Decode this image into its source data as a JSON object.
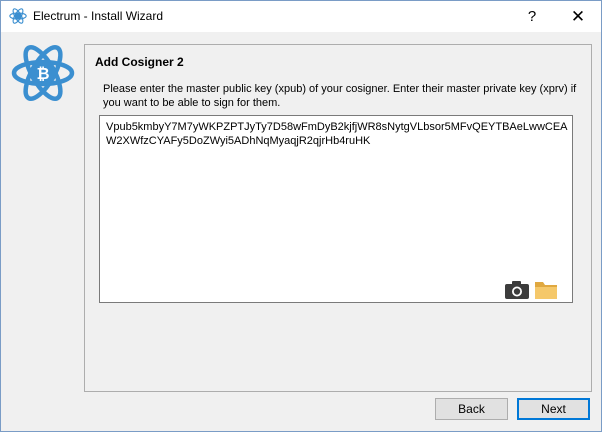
{
  "window": {
    "title": "Electrum  -  Install Wizard",
    "help_label": "?",
    "close_label": "✕"
  },
  "panel": {
    "heading": "Add Cosigner 2",
    "instructions": "Please enter the master public key (xpub) of your cosigner. Enter their master private key (xprv) if you want to be able to sign for them.",
    "key_value": "Vpub5kmbyY7M7yWKPZPTJyTy7D58wFmDyB2kjfjWR8sNytgVLbsor5MFvQEYTBAeLwwCEAW2XWfzCYAFy5DoZWyi5ADhNqMyaqjR2qjrHb4ruHK"
  },
  "buttons": {
    "back": "Back",
    "next": "Next"
  },
  "icons": {
    "app": "electrum-logo-icon",
    "camera": "camera-icon",
    "folder": "folder-icon"
  },
  "colors": {
    "accent": "#0078d7",
    "logo_blue": "#3b8fd0"
  }
}
